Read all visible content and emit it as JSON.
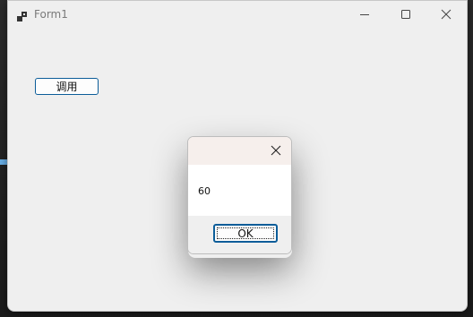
{
  "window": {
    "title": "Form1",
    "icon": "app-window-icon",
    "controls": [
      "minimize-icon",
      "maximize-icon",
      "close-icon"
    ]
  },
  "main": {
    "call_button_label": "调用"
  },
  "dialog": {
    "message": "60",
    "ok_label": "OK",
    "close_icon": "close-icon"
  },
  "colors": {
    "window_bg": "#efefef",
    "accent_border": "#0c5d99",
    "dialog_title_bg": "#f6efec"
  }
}
